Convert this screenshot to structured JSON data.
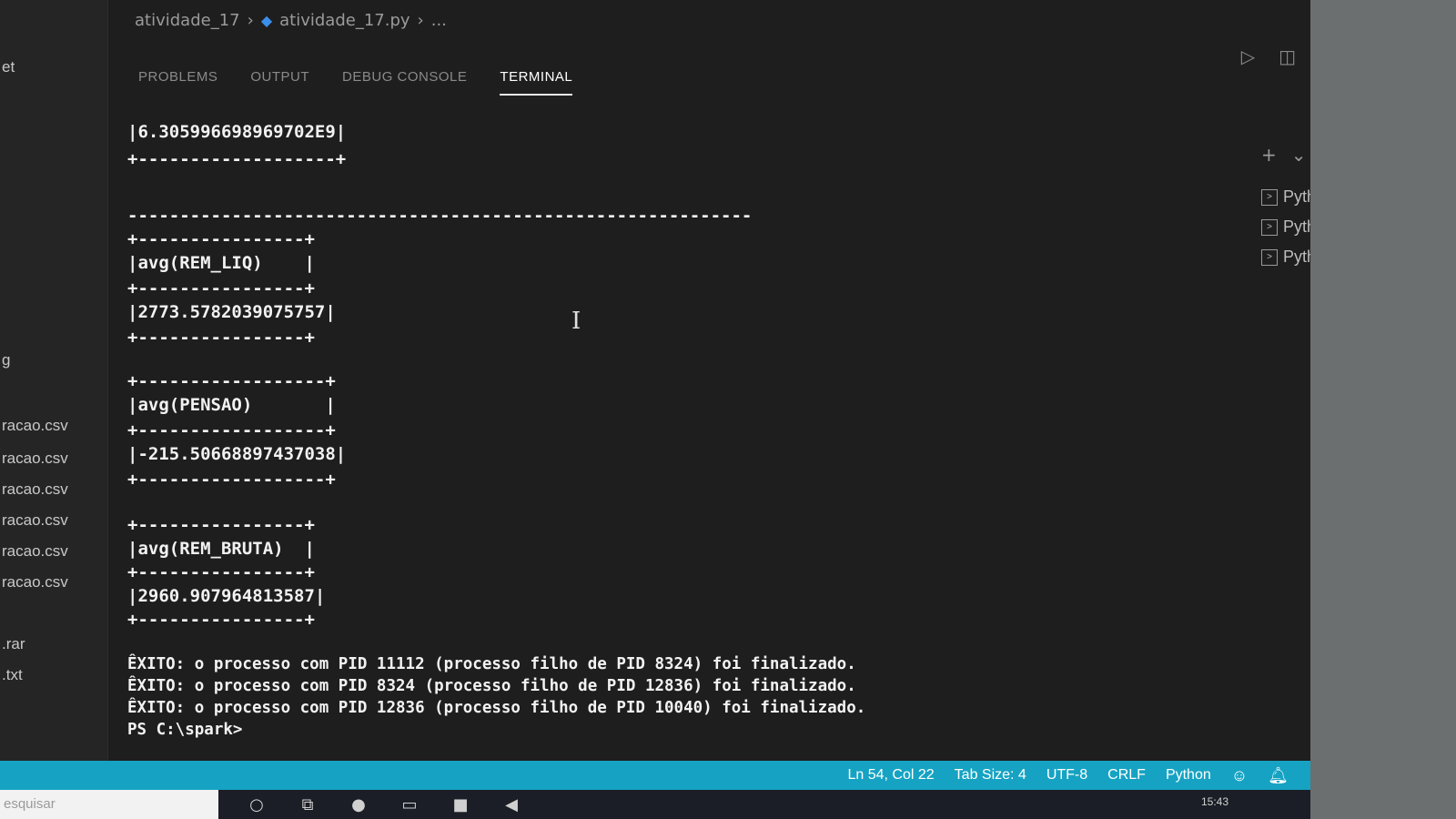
{
  "breadcrumb": {
    "folder": "atividade_17",
    "file": "atividade_17.py",
    "more": "..."
  },
  "panel_tabs": [
    {
      "label": "PROBLEMS",
      "active": false
    },
    {
      "label": "OUTPUT",
      "active": false
    },
    {
      "label": "DEBUG CONSOLE",
      "active": false
    },
    {
      "label": "TERMINAL",
      "active": true
    }
  ],
  "sidebar_fragments": [
    "et",
    "g",
    "racao.csv",
    "racao.csv",
    "racao.csv",
    "racao.csv",
    "racao.csv",
    "racao.csv",
    ".rar",
    ".txt"
  ],
  "terminal_sessions": [
    "Python",
    "Python",
    "Python"
  ],
  "terminal_lines": [
    "|6.305996698969702E9|",
    "+-------------------+",
    "------------------------------------------------------------",
    "+----------------+",
    "|avg(REM_LIQ)    |",
    "+----------------+",
    "|2773.5782039075757|",
    "+----------------+",
    "+------------------+",
    "|avg(PENSAO)       |",
    "+------------------+",
    "|-215.50668897437038|",
    "+------------------+",
    "+----------------+",
    "|avg(REM_BRUTA)  |",
    "+----------------+",
    "|2960.907964813587|",
    "+----------------+"
  ],
  "terminal_messages": [
    "ÊXITO: o processo com PID 11112 (processo filho de PID 8324) foi finalizado.",
    "ÊXITO: o processo com PID 8324 (processo filho de PID 12836) foi finalizado.",
    "ÊXITO: o processo com PID 12836 (processo filho de PID 10040) foi finalizado."
  ],
  "prompt": "PS C:\\spark>",
  "status": {
    "position": "Ln 54, Col 22",
    "tab_size": "Tab Size: 4",
    "encoding": "UTF-8",
    "eol": "CRLF",
    "language": "Python"
  },
  "taskbar": {
    "search_placeholder": "esquisar",
    "clock": "15:43"
  },
  "colors": {
    "status_bar": "#16a3c3",
    "terminal_bg": "#1e1e1e",
    "sidebar_bg": "#252526"
  }
}
